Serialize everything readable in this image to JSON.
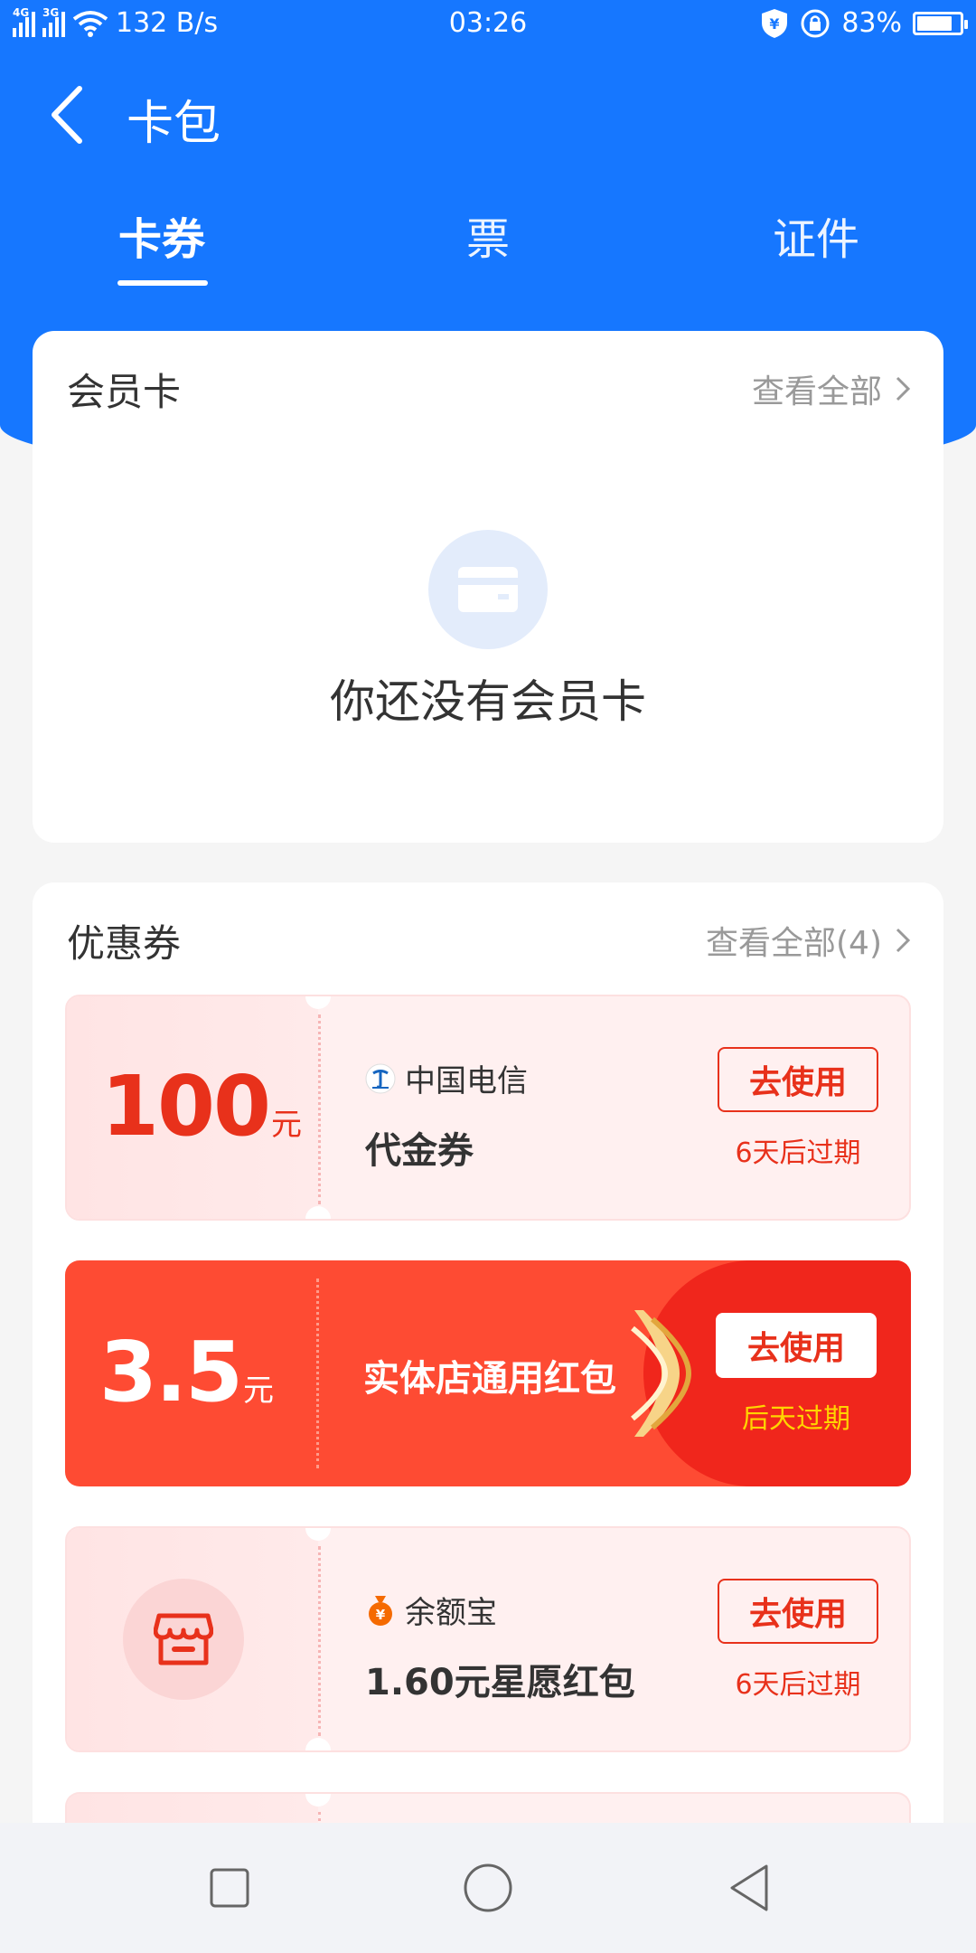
{
  "status_bar": {
    "net_4g": "4G",
    "net_3g": "3G",
    "speed": "132 B/s",
    "time": "03:26",
    "battery": "83%",
    "battery_level": 0.83
  },
  "nav": {
    "title": "卡包"
  },
  "tabs": [
    {
      "label": "卡券",
      "active": true
    },
    {
      "label": "票",
      "active": false
    },
    {
      "label": "证件",
      "active": false
    }
  ],
  "membership": {
    "title": "会员卡",
    "view_all": "查看全部",
    "empty_text": "你还没有会员卡"
  },
  "coupons_section": {
    "title": "优惠券",
    "view_all": "查看全部(4)",
    "items": [
      {
        "amount": "100",
        "unit": "元",
        "merchant": "中国电信",
        "name": "代金券",
        "button": "去使用",
        "expiry": "6天后过期"
      },
      {
        "amount": "3.5",
        "unit": "元",
        "name": "实体店通用红包",
        "button": "去使用",
        "expiry": "后天过期"
      },
      {
        "merchant": "余额宝",
        "name": "1.60元星愿红包",
        "button": "去使用",
        "expiry": "6天后过期"
      }
    ]
  },
  "colors": {
    "primary_blue": "#1677ff",
    "coupon_red": "#fe4b33",
    "accent_red": "#e8311b",
    "expiry_yellow": "#ffd400"
  }
}
